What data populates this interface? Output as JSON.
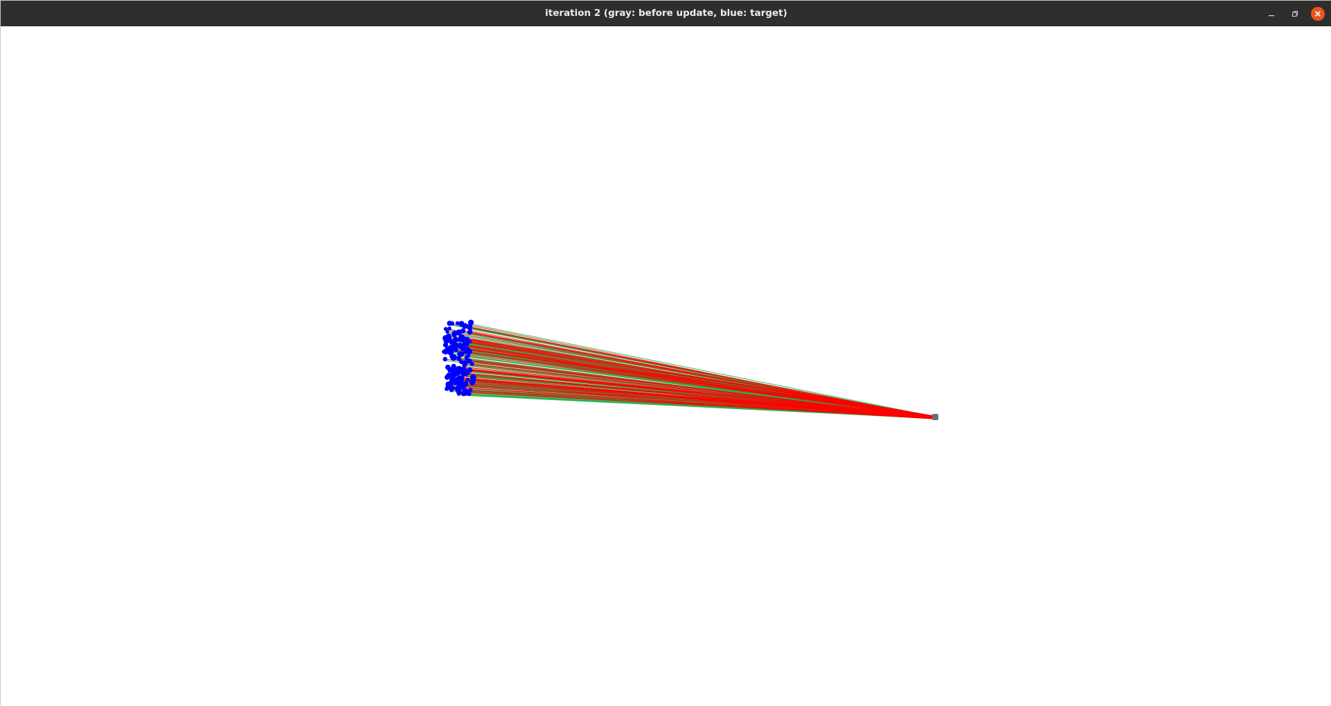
{
  "window": {
    "title": "iteration 2 (gray: before update, blue: target)",
    "buttons": {
      "minimize": "minimize-icon",
      "maximize": "restore-icon",
      "close": "close-icon"
    }
  },
  "scene": {
    "colors": {
      "target_points": "#0000ff",
      "source_point": "#6e6e6e",
      "correspondence_lines_a": "#ff0000",
      "correspondence_lines_b": "#22b14c",
      "titlebar": "#2f2e2d",
      "close_button": "#e95420"
    }
  }
}
